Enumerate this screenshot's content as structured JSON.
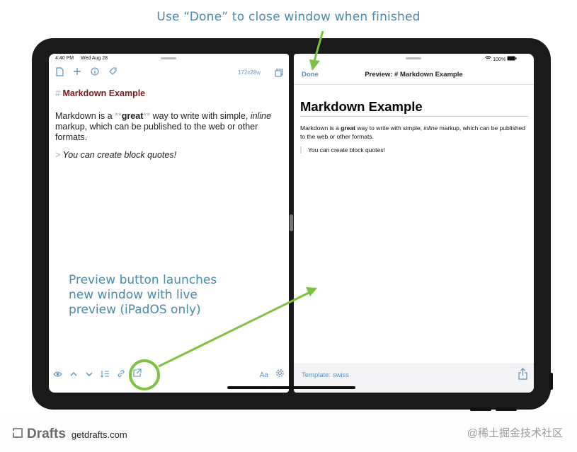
{
  "callouts": {
    "done": "Use “Done” to close window when finished",
    "preview": "Preview button launches new window with live preview (iPadOS only)"
  },
  "left_pane": {
    "status": {
      "time": "4:40 PM",
      "date": "Wed Aug 28"
    },
    "toolbar": {
      "icons": [
        "document-icon",
        "plus-icon",
        "info-icon",
        "tag-icon"
      ],
      "draft_id": "172c28w",
      "right_icon": "windows-icon"
    },
    "editor": {
      "heading_mark": "#",
      "heading_text": "Markdown Example",
      "p1_before": "Markdown is a ",
      "p1_bold_mark": "**",
      "p1_bold": "great",
      "p1_mid": " way to write with simple, ",
      "p1_italic": "inline",
      "p1_after": " markup, which can be published to the web or other formats.",
      "quote_mark": ">",
      "quote_text": "You can create block quotes!"
    },
    "bottom_toolbar": {
      "icons": [
        "eye-icon",
        "chevron-up-icon",
        "chevron-down-icon",
        "list-arrange-icon",
        "link-icon",
        "preview-launch-icon"
      ],
      "font_label": "Aa",
      "right_icon": "gear-icon"
    }
  },
  "right_pane": {
    "status": {
      "battery": "100%"
    },
    "nav": {
      "done_label": "Done",
      "title": "Preview: # Markdown Example"
    },
    "content": {
      "heading": "Markdown Example",
      "p1_before": "Markdown is a ",
      "p1_bold": "great",
      "p1_mid": " way to write with simple, ",
      "p1_italic": "inline",
      "p1_after": " markup, which can be published to the web or other formats.",
      "quote": "You can create block quotes!"
    },
    "footer": {
      "template_label": "Template: swiss",
      "share_icon": "share-icon"
    }
  },
  "footer": {
    "brand_name": "Drafts",
    "brand_url": "getdrafts.com",
    "watermark": "@稀土掘金技术社区"
  },
  "colors": {
    "accent": "#5b8fc0",
    "callout": "#4a8aaa",
    "highlight": "#7dc241",
    "heading": "#7a1a1a",
    "device": "#1a1a1a"
  }
}
